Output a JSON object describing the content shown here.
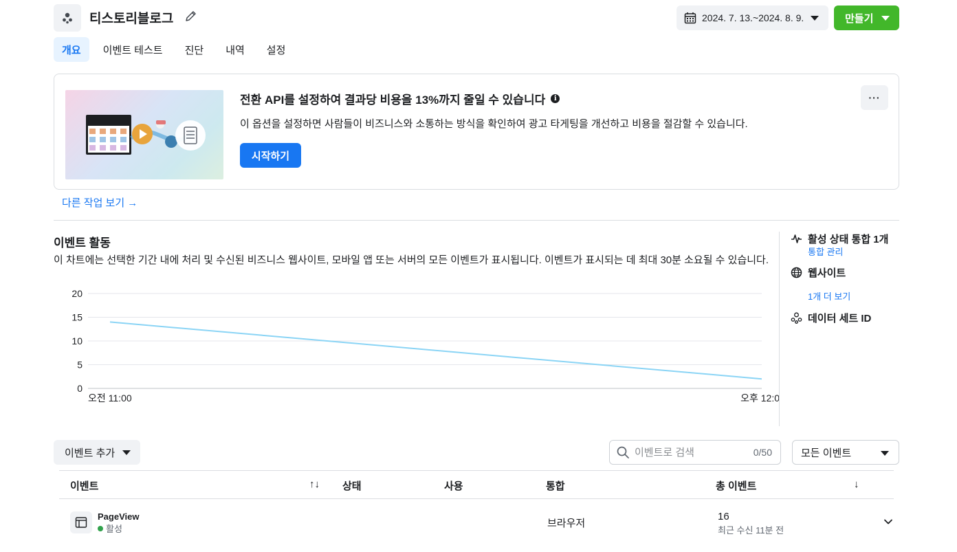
{
  "header": {
    "title": "티스토리블로그",
    "date_range": "2024. 7. 13.~2024. 8. 9.",
    "create_label": "만들기"
  },
  "tabs": [
    {
      "label": "개요",
      "active": true
    },
    {
      "label": "이벤트 테스트",
      "active": false
    },
    {
      "label": "진단",
      "active": false
    },
    {
      "label": "내역",
      "active": false
    },
    {
      "label": "설정",
      "active": false
    }
  ],
  "promo": {
    "title": "전환 API를 설정하여 결과당 비용을 13%까지 줄일 수 있습니다",
    "description": "이 옵션을 설정하면 사람들이 비즈니스와 소통하는 방식을 확인하여 광고 타게팅을 개선하고 비용을 절감할 수 있습니다.",
    "button": "시작하기",
    "more": "···"
  },
  "other_tasks_link": "다른 작업 보기 →",
  "activity": {
    "title": "이벤트 활동",
    "description": "이 차트에는 선택한 기간 내에 처리 및 수신된 비즈니스 웹사이트, 모바일 앱 또는 서버의 모든 이벤트가 표시됩니다. 이벤트가 표시되는 데 최대 30분 소요될 수 있습니다."
  },
  "chart_data": {
    "type": "line",
    "x": [
      "오전 11:00",
      "오후 12:0"
    ],
    "series": [
      {
        "values": [
          14,
          2
        ],
        "color": "#8ad4f5"
      }
    ],
    "yticks": [
      0,
      5,
      10,
      15,
      20
    ],
    "ylim": [
      0,
      20
    ],
    "grid": true
  },
  "side": {
    "active_integration": "활성 상태 통합 1개",
    "manage_link": "통합 관리",
    "website": "웹사이트",
    "more_link": "1개 더 보기",
    "dataset_id": "데이터 세트 ID"
  },
  "toolbar": {
    "add_event": "이벤트 추가",
    "search_placeholder": "이벤트로 검색",
    "search_count": "0/50",
    "filter": "모든 이벤트"
  },
  "table": {
    "headers": {
      "event": "이벤트",
      "status": "상태",
      "usage": "사용",
      "integration": "통합",
      "total": "총 이벤트"
    },
    "sort_icon": "↑↓",
    "sort_down": "↓",
    "rows": [
      {
        "name": "PageView",
        "status": "활성",
        "integration": "브라우저",
        "total": "16",
        "recent": "최근 수신 11분 전"
      }
    ]
  }
}
